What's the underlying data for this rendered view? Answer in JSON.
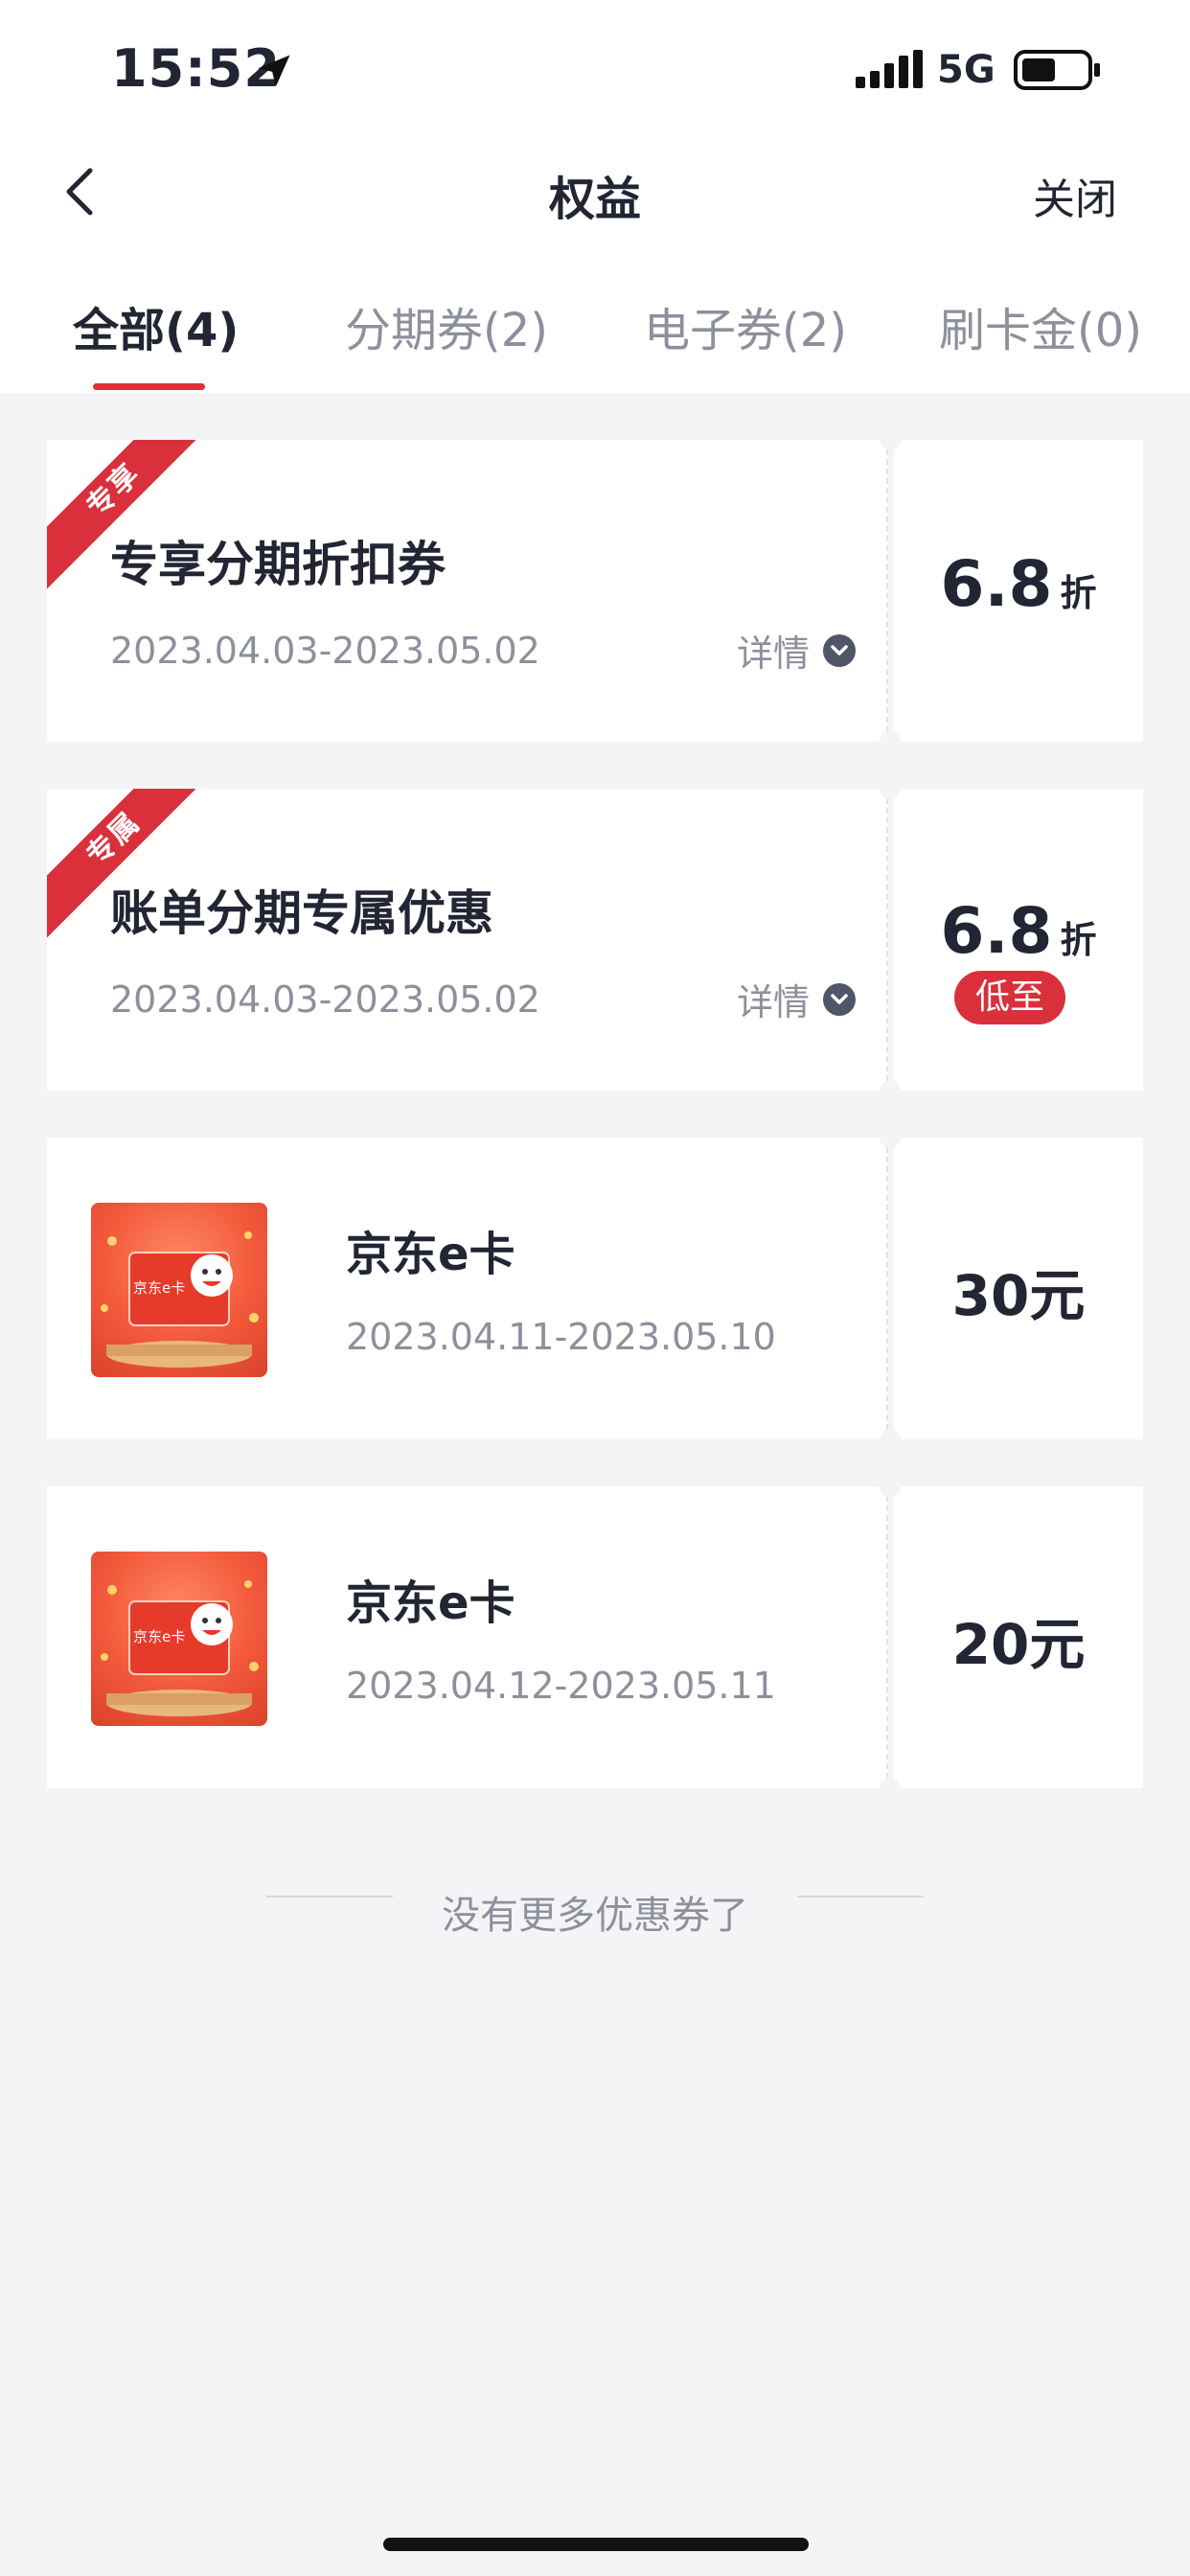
{
  "status_bar": {
    "time": "15:52",
    "network": "5G"
  },
  "nav": {
    "title": "权益",
    "close_label": "关闭"
  },
  "tabs": [
    {
      "label": "全部(4)",
      "active": true
    },
    {
      "label": "分期券(2)",
      "active": false
    },
    {
      "label": "电子券(2)",
      "active": false
    },
    {
      "label": "刷卡金(0)",
      "active": false
    }
  ],
  "coupons": [
    {
      "tag": "专享",
      "title": "专享分期折扣券",
      "date": "2023.04.03-2023.05.02",
      "detail_label": "详情",
      "value": "6.8",
      "unit": "折"
    },
    {
      "tag": "专属",
      "title": "账单分期专属优惠",
      "date": "2023.04.03-2023.05.02",
      "detail_label": "详情",
      "value": "6.8",
      "unit": "折",
      "badge": "低至"
    },
    {
      "title": "京东e卡",
      "date": "2023.04.11-2023.05.10",
      "value": "30元",
      "card_text": "京东e卡"
    },
    {
      "title": "京东e卡",
      "date": "2023.04.12-2023.05.11",
      "value": "20元",
      "card_text": "京东e卡"
    }
  ],
  "footer": {
    "end_text": "没有更多优惠券了"
  },
  "colors": {
    "accent": "#d9303c",
    "text": "#222533",
    "muted": "#8d909c",
    "background": "#f4f4f6"
  }
}
